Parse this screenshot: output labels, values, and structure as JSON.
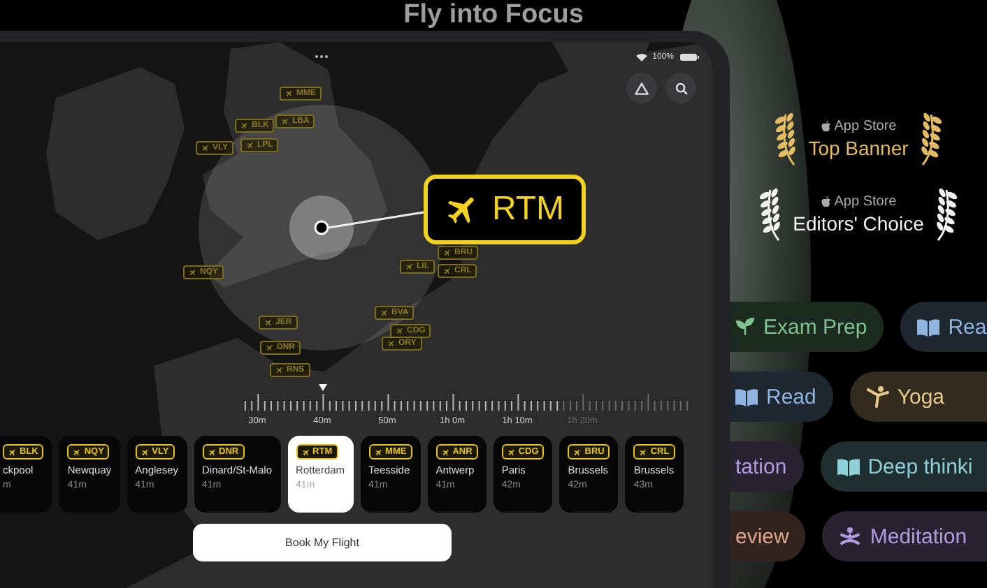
{
  "headline": "Fly into Focus",
  "status_bar": {
    "battery": "100%"
  },
  "map": {
    "airports": [
      {
        "code": "MME"
      },
      {
        "code": "BLK"
      },
      {
        "code": "LBA"
      },
      {
        "code": "VLY"
      },
      {
        "code": "LPL"
      },
      {
        "code": "NQY"
      },
      {
        "code": "BRU"
      },
      {
        "code": "LIL"
      },
      {
        "code": "CRL"
      },
      {
        "code": "JER"
      },
      {
        "code": "DNR"
      },
      {
        "code": "RNS"
      },
      {
        "code": "BVA"
      },
      {
        "code": "CDG"
      },
      {
        "code": "ORY"
      }
    ],
    "origin_callout": {
      "code": "RTM"
    }
  },
  "ruler": {
    "labels": [
      "30m",
      "40m",
      "50m",
      "1h 0m",
      "1h 10m",
      "1h 20m"
    ]
  },
  "destinations": [
    {
      "code": "BLK",
      "name": "ckpool",
      "time": "m",
      "selected": false
    },
    {
      "code": "NQY",
      "name": "Newquay",
      "time": "41m",
      "selected": false
    },
    {
      "code": "VLY",
      "name": "Anglesey",
      "time": "41m",
      "selected": false
    },
    {
      "code": "DNR",
      "name": "Dinard/St-Malo",
      "time": "41m",
      "selected": false
    },
    {
      "code": "RTM",
      "name": "Rotterdam",
      "time": "41m",
      "selected": true
    },
    {
      "code": "MME",
      "name": "Teesside",
      "time": "41m",
      "selected": false
    },
    {
      "code": "ANR",
      "name": "Antwerp",
      "time": "41m",
      "selected": false
    },
    {
      "code": "CDG",
      "name": "Paris",
      "time": "42m",
      "selected": false
    },
    {
      "code": "BRU",
      "name": "Brussels",
      "time": "42m",
      "selected": false
    },
    {
      "code": "CRL",
      "name": "Brussels",
      "time": "43m",
      "selected": false
    }
  ],
  "book_button": "Book My Flight",
  "awards": [
    {
      "store": "App Store",
      "title": "Top Banner",
      "color": "#e2bb62"
    },
    {
      "store": "App Store",
      "title": "Editors' Choice",
      "color": "#f2f2f2"
    }
  ],
  "chip_rows": [
    [
      {
        "label": "Exam Prep",
        "kind": "sprout",
        "color": "#7fc48f"
      },
      {
        "label": "Rea",
        "kind": "book",
        "color": "#8fb4e0"
      }
    ],
    [
      {
        "label": "Read",
        "kind": "book",
        "color": "#8fb4e0"
      },
      {
        "label": "Yoga",
        "kind": "yoga",
        "color": "#e6c98a"
      }
    ],
    [
      {
        "label": "tation",
        "kind": "none",
        "color": "#b49ae0"
      },
      {
        "label": "Deep thinki",
        "kind": "book",
        "color": "#8fd0d8"
      }
    ],
    [
      {
        "label": "eview",
        "kind": "none",
        "color": "#e0a58f"
      },
      {
        "label": "Meditation",
        "kind": "meditation",
        "color": "#b49ae0"
      }
    ]
  ]
}
